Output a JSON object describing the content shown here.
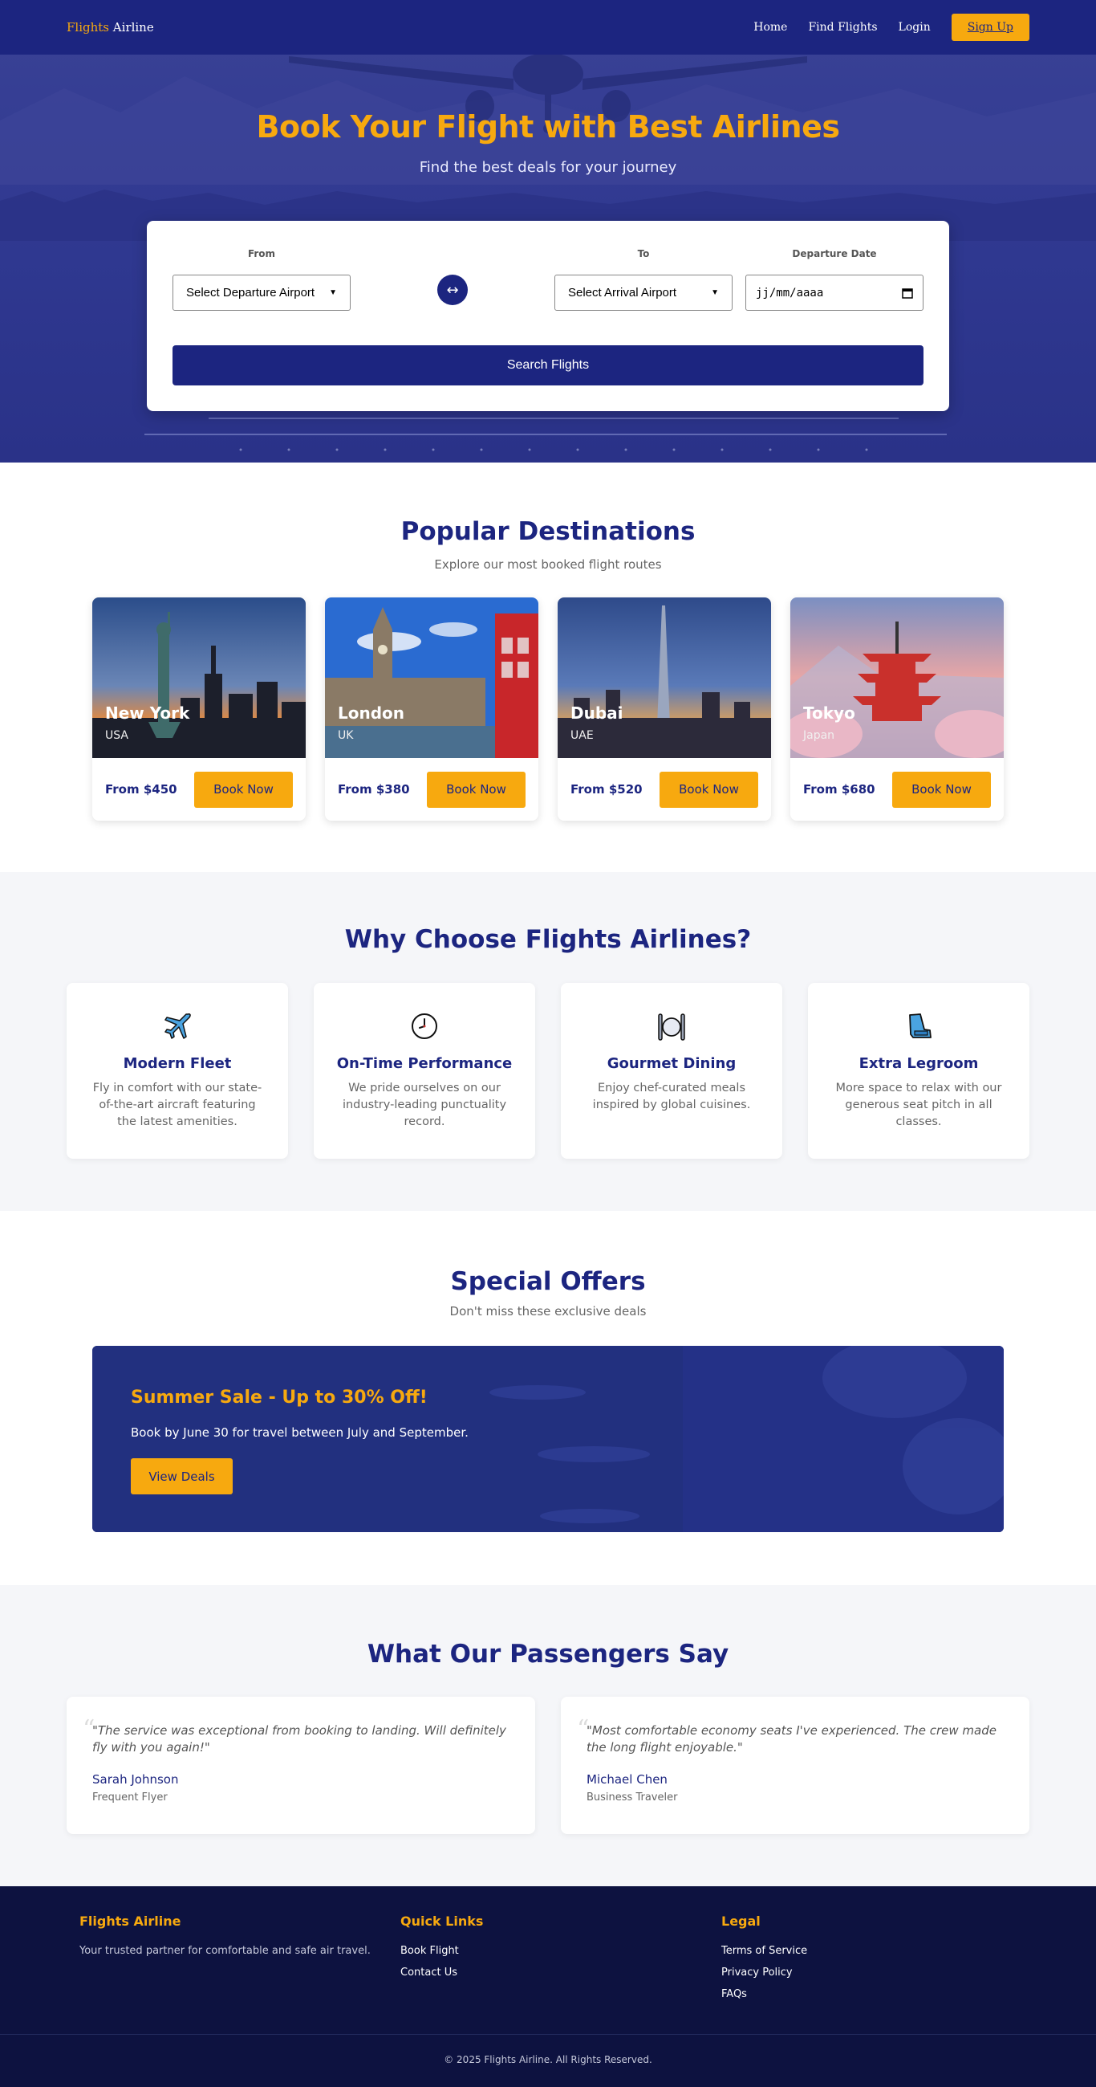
{
  "nav": {
    "brand_accent": "Flights",
    "brand_rest": " Airline",
    "links": [
      "Home",
      "Find Flights",
      "Login"
    ],
    "signup": "Sign Up"
  },
  "hero": {
    "title": "Book Your Flight with Best Airlines",
    "subtitle": "Find the best deals for your journey"
  },
  "search": {
    "from_label": "From",
    "from_value": "Select Departure Airport",
    "swap_icon": "↔",
    "to_label": "To",
    "to_value": "Select Arrival Airport",
    "date_label": "Departure Date",
    "date_value": "jj/mm/aaaa",
    "button": "Search Flights"
  },
  "destinations": {
    "title": "Popular Destinations",
    "subtitle": "Explore our most booked flight routes",
    "items": [
      {
        "city": "New York",
        "country": "USA",
        "price": "From $450",
        "button": "Book Now"
      },
      {
        "city": "London",
        "country": "UK",
        "price": "From $380",
        "button": "Book Now"
      },
      {
        "city": "Dubai",
        "country": "UAE",
        "price": "From $520",
        "button": "Book Now"
      },
      {
        "city": "Tokyo",
        "country": "Japan",
        "price": "From $680",
        "button": "Book Now"
      }
    ]
  },
  "why": {
    "title": "Why Choose Flights Airlines?",
    "features": [
      {
        "icon": "airplane-icon",
        "title": "Modern Fleet",
        "text": "Fly in comfort with our state-of-the-art aircraft featuring the latest amenities."
      },
      {
        "icon": "clock-icon",
        "title": "On-Time Performance",
        "text": "We pride ourselves on our industry-leading punctuality record."
      },
      {
        "icon": "dining-icon",
        "title": "Gourmet Dining",
        "text": "Enjoy chef-curated meals inspired by global cuisines."
      },
      {
        "icon": "seat-icon",
        "title": "Extra Legroom",
        "text": "More space to relax with our generous seat pitch in all classes."
      }
    ]
  },
  "offers": {
    "title": "Special Offers",
    "subtitle": "Don't miss these exclusive deals",
    "card_title": "Summer Sale - Up to 30% Off!",
    "card_text": "Book by June 30 for travel between July and September.",
    "card_button": "View Deals"
  },
  "testimonials": {
    "title": "What Our Passengers Say",
    "items": [
      {
        "quote": "\"The service was exceptional from booking to landing. Will definitely fly with you again!\"",
        "name": "Sarah Johnson",
        "role": "Frequent Flyer"
      },
      {
        "quote": "\"Most comfortable economy seats I've experienced. The crew made the long flight enjoyable.\"",
        "name": "Michael Chen",
        "role": "Business Traveler"
      }
    ]
  },
  "footer": {
    "brand_heading": "Flights Airline",
    "brand_text": "Your trusted partner for comfortable and safe air travel.",
    "quick_heading": "Quick Links",
    "quick_links": [
      "Book Flight",
      "Contact Us"
    ],
    "legal_heading": "Legal",
    "legal_links": [
      "Terms of Service",
      "Privacy Policy",
      "FAQs"
    ],
    "copyright": "© 2025 Flights Airline. All Rights Reserved."
  },
  "colors": {
    "primary": "#1c2580",
    "accent": "#f7a90f",
    "footer_bg": "#0d1240",
    "section_bg": "#f5f6f9"
  }
}
